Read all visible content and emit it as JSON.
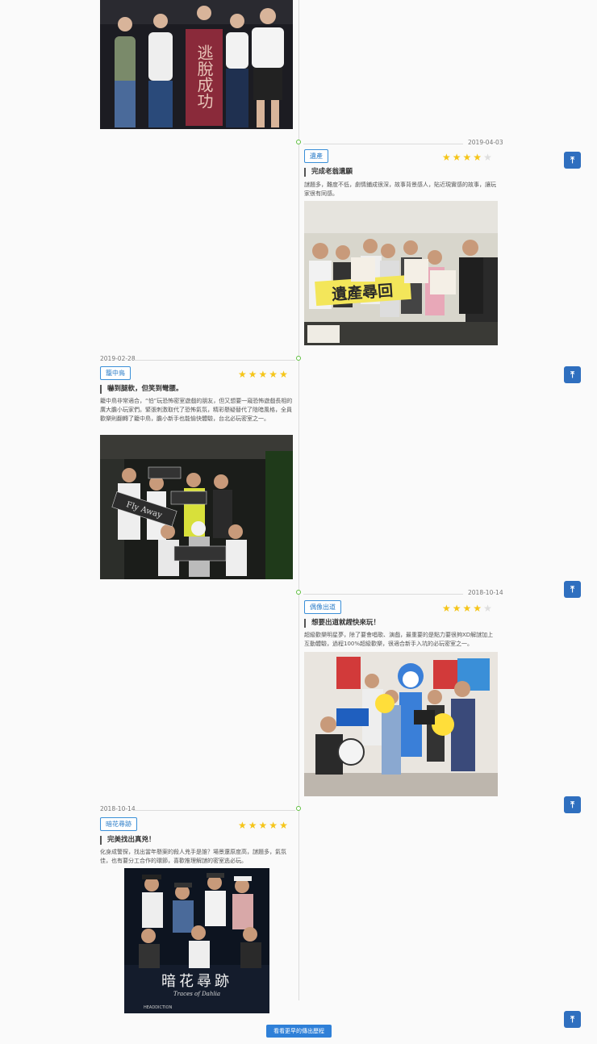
{
  "timeline": {
    "entries": [
      {
        "date": "2019-04-03",
        "tag": "遺產",
        "stars": 4,
        "title": "完成老翁遺願",
        "desc": "謎題多，難度不低，劇情鋪成很深，故事背景感人，貼近現實感的故事，讓玩家很有同感。",
        "photo_label": "遺產尋回"
      },
      {
        "date": "2019-02-28",
        "tag": "籠中鳥",
        "stars": 5,
        "title": "嚇到腿軟，但笑到彎腰。",
        "desc": "籠中鳥非常適合，“怕”玩恐怖密室遊戲的朋友，但又想要一窺恐怖遊戲長相的廣大膽小玩家們。緊張刺激取代了恐怖氣氛，精彩懸疑替代了陰暗風格，全員歡樂則翻轉了籠中鳥，膽小新手也能愉快體驗，台北必玩密室之一。",
        "photo_label": "Fly Away"
      },
      {
        "date": "2018-10-14",
        "tag": "偶像出道",
        "stars": 4,
        "title": "想要出道就趕快來玩！",
        "desc": "超級歡樂明星夢，除了要會唱歌、演戲，最重要的是點力要很夠XD解謎加上互動體驗，過程100%超級歡樂，很適合新手入坑的必玩密室之一。",
        "photo_label": ""
      },
      {
        "date": "2018-10-14",
        "tag": "暗花尋跡",
        "stars": 5,
        "title": "完美找出真兇！",
        "desc": "化身成警探，找出當年懸案的殺人兇手是誰？場景還原度高，謎題多，氣氛佳，也有要分工合作的環節，喜歡推理解謎的密室逃必玩。",
        "photo_label": "暗花尋跡",
        "photo_sublabel": "Traces of Dahlia",
        "photo_brand": "HEADDICTION"
      }
    ],
    "top_photo_label": "逃脫成功"
  },
  "back_to_top_icon": "arrow-up-to-line-icon",
  "back_to_top_glyph": "⤒",
  "more_button_label": "看看更早的傳出歷程",
  "colors": {
    "accent": "#2f80d8",
    "dot": "#5fbf3f",
    "star_on": "#f5c518",
    "star_off": "#dedede"
  }
}
